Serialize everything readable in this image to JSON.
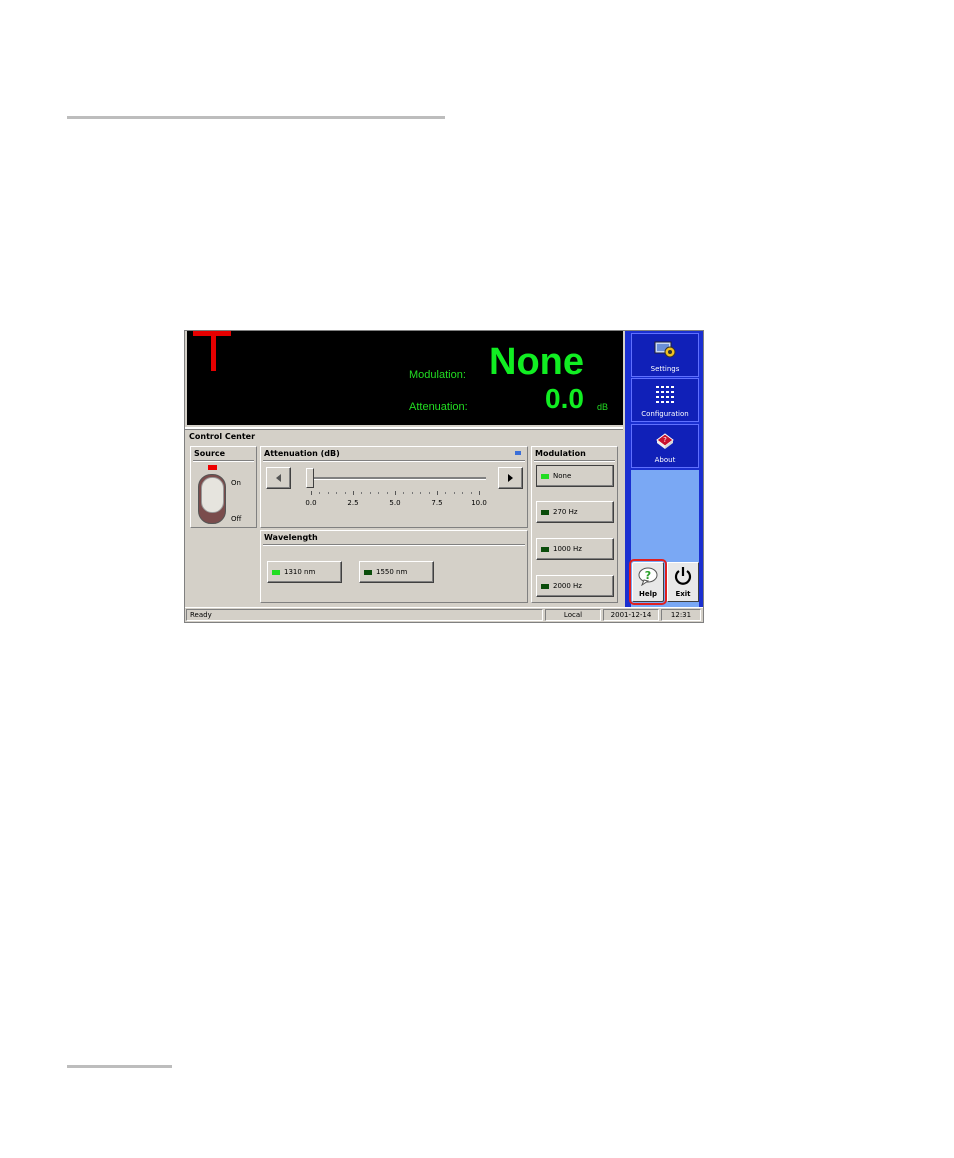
{
  "display": {
    "modulation_label": "Modulation:",
    "modulation_value": "None",
    "attenuation_label": "Attenuation:",
    "attenuation_value": "0.0",
    "attenuation_unit": "dB"
  },
  "control_center": {
    "title": "Control Center",
    "source": {
      "title": "Source",
      "on_label": "On",
      "off_label": "Off"
    },
    "attenuation": {
      "title": "Attenuation (dB)",
      "scale": [
        "0.0",
        "2.5",
        "5.0",
        "7.5",
        "10.0"
      ],
      "value": 0.0,
      "min": 0.0,
      "max": 10.0
    },
    "wavelength": {
      "title": "Wavelength",
      "options": [
        "1310 nm",
        "1550 nm"
      ],
      "selected": "1310 nm"
    },
    "modulation": {
      "title": "Modulation",
      "options": [
        "None",
        "270 Hz",
        "1000 Hz",
        "2000 Hz"
      ],
      "selected": "None"
    }
  },
  "sidebar": {
    "settings_label": "Settings",
    "configuration_label": "Configuration",
    "about_label": "About",
    "help_label": "Help",
    "exit_label": "Exit"
  },
  "statusbar": {
    "status": "Ready",
    "mode": "Local",
    "date": "2001-12-14",
    "time": "12:31"
  },
  "colors": {
    "display_text": "#11ee22",
    "sidebar_blue": "#1a2fd0",
    "help_highlight": "#e02020"
  }
}
